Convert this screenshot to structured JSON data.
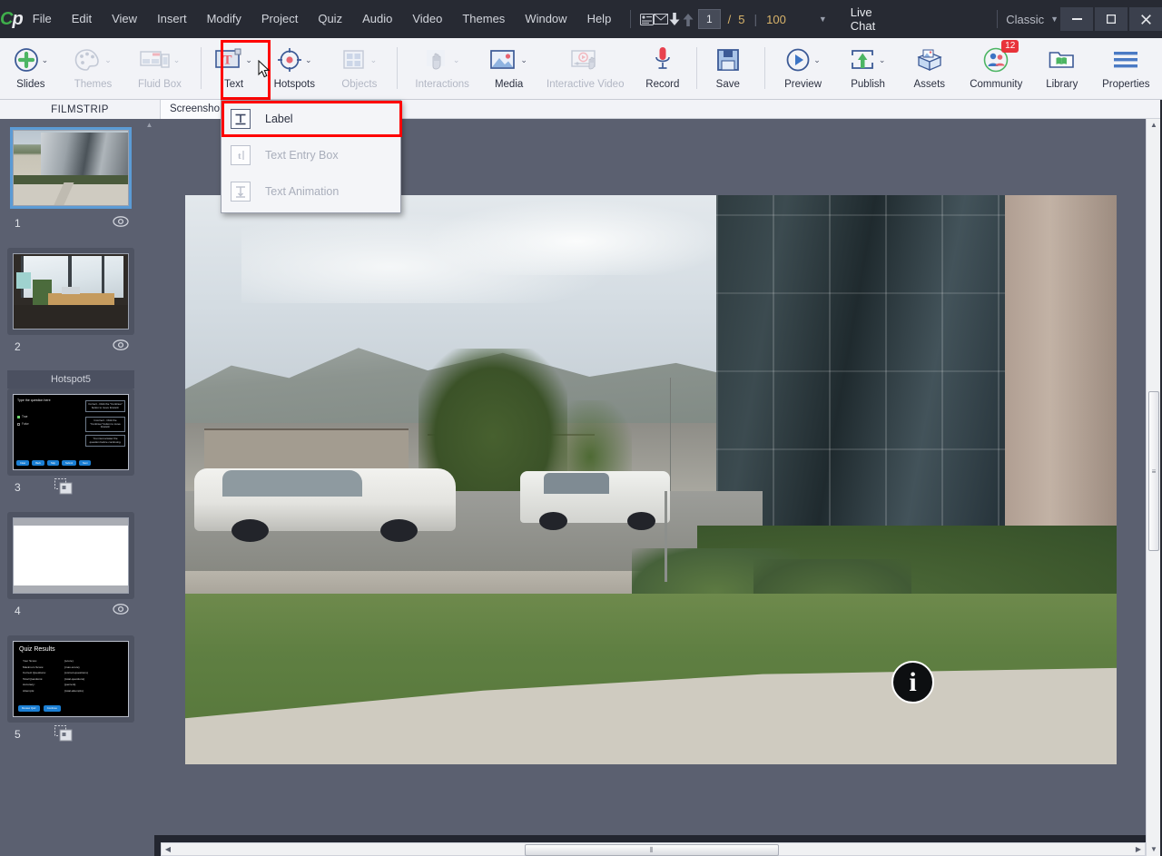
{
  "app": {
    "logo": "Cp",
    "theme_selector": "Classic",
    "live_chat": "Live Chat"
  },
  "menubar": {
    "items": [
      "File",
      "Edit",
      "View",
      "Insert",
      "Modify",
      "Project",
      "Quiz",
      "Audio",
      "Video",
      "Themes",
      "Window",
      "Help"
    ],
    "icons": [
      "slide-notes-icon",
      "mail-icon",
      "download-arrow-icon",
      "upload-arrow-icon"
    ],
    "current_slide": "1",
    "slide_separator": "/",
    "total_slides": "5",
    "zoom_level": "100",
    "window_controls": {
      "minimize": "—",
      "maximize": "▢",
      "close": "✕"
    }
  },
  "ribbon": {
    "items": [
      {
        "label": "Slides",
        "icon": "plus-circle-icon",
        "disabled": false,
        "has_caret": true
      },
      {
        "label": "Themes",
        "icon": "palette-icon",
        "disabled": true,
        "has_caret": true
      },
      {
        "label": "Fluid Box",
        "icon": "fluid-box-icon",
        "disabled": true,
        "has_caret": true
      },
      {
        "label": "Text",
        "icon": "text-T-icon",
        "disabled": false,
        "has_caret": true,
        "highlighted": true
      },
      {
        "label": "Hotspots",
        "icon": "hotspot-target-icon",
        "disabled": false,
        "has_caret": true
      },
      {
        "label": "Objects",
        "icon": "objects-grid-icon",
        "disabled": true,
        "has_caret": true
      },
      {
        "label": "Interactions",
        "icon": "hand-interaction-icon",
        "disabled": true,
        "has_caret": true
      },
      {
        "label": "Media",
        "icon": "image-media-icon",
        "disabled": false,
        "has_caret": true
      },
      {
        "label": "Interactive Video",
        "icon": "interactive-video-icon",
        "disabled": true,
        "has_caret": false
      },
      {
        "label": "Record",
        "icon": "microphone-icon",
        "disabled": false,
        "has_caret": false
      },
      {
        "label": "Save",
        "icon": "floppy-disk-icon",
        "disabled": false,
        "has_caret": false
      },
      {
        "label": "Preview",
        "icon": "play-circle-icon",
        "disabled": false,
        "has_caret": true
      },
      {
        "label": "Publish",
        "icon": "publish-upload-icon",
        "disabled": false,
        "has_caret": true
      },
      {
        "label": "Assets",
        "icon": "assets-box-icon",
        "disabled": false,
        "has_caret": false
      },
      {
        "label": "Community",
        "icon": "community-people-icon",
        "disabled": false,
        "has_caret": false,
        "badge": "12"
      },
      {
        "label": "Library",
        "icon": "library-folder-icon",
        "disabled": false,
        "has_caret": false
      },
      {
        "label": "Properties",
        "icon": "hamburger-lines-icon",
        "disabled": false,
        "has_caret": false
      }
    ],
    "highlight_color": "#ff0000",
    "badge_color": "#e8333a"
  },
  "text_dropdown": {
    "items": [
      {
        "label": "Label",
        "icon": "label-T-icon",
        "disabled": false,
        "selected": true
      },
      {
        "label": "Text Entry Box",
        "icon": "text-entry-icon",
        "disabled": true,
        "selected": false
      },
      {
        "label": "Text Animation",
        "icon": "text-animation-icon",
        "disabled": true,
        "selected": false
      }
    ]
  },
  "filmstrip": {
    "title": "FILMSTRIP",
    "slides": [
      {
        "number": "1",
        "group_label": "",
        "selected": true,
        "type": "photo-exterior",
        "has_eye": true
      },
      {
        "number": "2",
        "group_label": "",
        "selected": false,
        "type": "photo-office",
        "has_eye": true
      },
      {
        "number": "3",
        "group_label": "Hotspot5",
        "selected": false,
        "type": "quiz-question",
        "has_eye": false
      },
      {
        "number": "4",
        "group_label": "",
        "selected": false,
        "type": "blank",
        "has_eye": true
      },
      {
        "number": "5",
        "group_label": "",
        "selected": false,
        "type": "quiz-results",
        "has_eye": false
      }
    ]
  },
  "quiz_question_thumb": {
    "prompt": "Type the question here",
    "options": [
      "True",
      "False"
    ],
    "feedback": [
      "Correct - Click the \"Continue\" button to move forward.",
      "Incorrect - Click the \"Continue\" button to move forward.",
      "You must answer the question before continuing."
    ],
    "buttons": [
      "Clear",
      "Back",
      "Skip",
      "Submit",
      "Next"
    ]
  },
  "quiz_results_thumb": {
    "title": "Quiz Results",
    "rows": [
      {
        "label": "Your Score:",
        "value": "{score}"
      },
      {
        "label": "Maximum Score:",
        "value": "{max-score}"
      },
      {
        "label": "Correct Questions:",
        "value": "{correct-questions}"
      },
      {
        "label": "Total Questions:",
        "value": "{total-questions}"
      },
      {
        "label": "Accuracy:",
        "value": "{percent}"
      },
      {
        "label": "Attempts:",
        "value": "{total-attempts}"
      }
    ],
    "buttons": [
      "Review Quiz",
      "Continue"
    ]
  },
  "stage": {
    "tab_label": "Screensho",
    "canvas_content": "office-building-parking-lot-photo",
    "hotspot_marker": "i"
  },
  "scrollbars": {
    "horizontal_grip": "⦀",
    "vertical_grip": "≡"
  },
  "colors": {
    "titlebar_bg": "#272a33",
    "ribbon_bg": "#f2f3f7",
    "panel_bg": "#5b6070",
    "accent_blue": "#3c5a96",
    "highlight_red": "#ff0000",
    "selection_blue": "#5b9bd5",
    "green_accent": "#3fae4b"
  }
}
